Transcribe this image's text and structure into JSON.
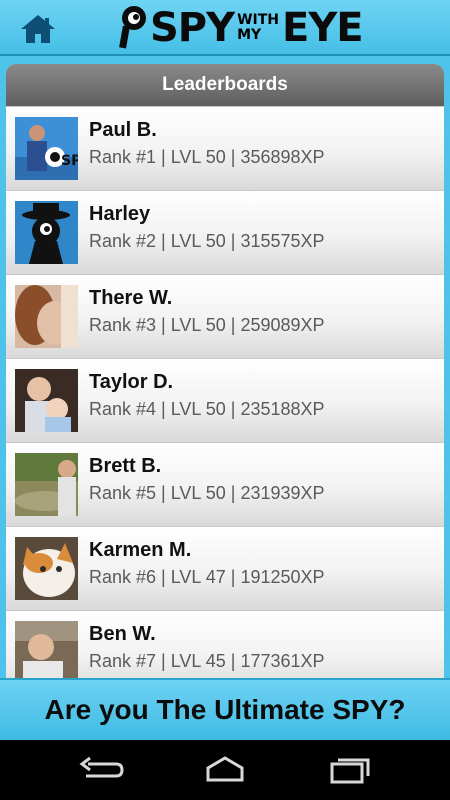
{
  "app": {
    "logo_parts": [
      "SPY",
      "WITH",
      "MY",
      "EYE"
    ],
    "colors": {
      "header_blue": "#45bfe6",
      "panel_title_gray": "#6e6e6e",
      "text_dark": "#111111"
    }
  },
  "header": {
    "home_icon": "home-icon"
  },
  "leaderboard": {
    "title": "Leaderboards",
    "entries": [
      {
        "name": "Paul B.",
        "stats": "Rank #1 | LVL 50 | 356898XP"
      },
      {
        "name": "Harley",
        "stats": "Rank #2 | LVL 50 | 315575XP"
      },
      {
        "name": "There W.",
        "stats": "Rank #3 | LVL 50 | 259089XP"
      },
      {
        "name": "Taylor D.",
        "stats": "Rank #4 | LVL 50 | 235188XP"
      },
      {
        "name": "Brett B.",
        "stats": "Rank #5 | LVL 50 | 231939XP"
      },
      {
        "name": "Karmen M.",
        "stats": "Rank #6 | LVL 47 | 191250XP"
      },
      {
        "name": "Ben W.",
        "stats": "Rank #7 | LVL 45 | 177361XP"
      }
    ]
  },
  "banner": {
    "text": "Are you The Ultimate SPY?"
  },
  "navbar": {
    "icons": [
      "back-icon",
      "home-nav-icon",
      "recent-apps-icon"
    ]
  }
}
